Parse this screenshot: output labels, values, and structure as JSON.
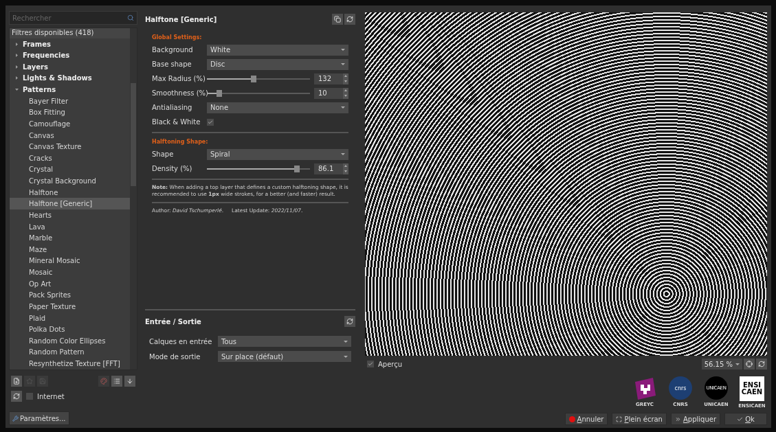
{
  "search": {
    "placeholder": "Rechercher"
  },
  "filters": {
    "header": "Filtres disponibles (418)",
    "categories": [
      {
        "label": "Frames",
        "expanded": false,
        "selected": false
      },
      {
        "label": "Frequencies",
        "expanded": false,
        "selected": false
      },
      {
        "label": "Layers",
        "expanded": false,
        "selected": false
      },
      {
        "label": "Lights & Shadows",
        "expanded": false,
        "selected": false
      },
      {
        "label": "Patterns",
        "expanded": true,
        "selected": false,
        "children": [
          {
            "label": "Bayer Filter",
            "selected": false
          },
          {
            "label": "Box Fitting",
            "selected": false
          },
          {
            "label": "Camouflage",
            "selected": false
          },
          {
            "label": "Canvas",
            "selected": false
          },
          {
            "label": "Canvas Texture",
            "selected": false
          },
          {
            "label": "Cracks",
            "selected": false
          },
          {
            "label": "Crystal",
            "selected": false
          },
          {
            "label": "Crystal Background",
            "selected": false
          },
          {
            "label": "Halftone",
            "selected": false
          },
          {
            "label": "Halftone [Generic]",
            "selected": true
          },
          {
            "label": "Hearts",
            "selected": false
          },
          {
            "label": "Lava",
            "selected": false
          },
          {
            "label": "Marble",
            "selected": false
          },
          {
            "label": "Maze",
            "selected": false
          },
          {
            "label": "Mineral Mosaic",
            "selected": false
          },
          {
            "label": "Mosaic",
            "selected": false
          },
          {
            "label": "Op Art",
            "selected": false
          },
          {
            "label": "Pack Sprites",
            "selected": false
          },
          {
            "label": "Paper Texture",
            "selected": false
          },
          {
            "label": "Plaid",
            "selected": false
          },
          {
            "label": "Polka Dots",
            "selected": false
          },
          {
            "label": "Random Color Ellipses",
            "selected": false
          },
          {
            "label": "Random Pattern",
            "selected": false
          },
          {
            "label": "Resynthetize Texture [FFT]",
            "selected": false
          }
        ]
      }
    ]
  },
  "internet": {
    "label": "Internet",
    "checked": false
  },
  "settings_button": "Paramètres...",
  "filter": {
    "title": "Halftone [Generic]",
    "params": [
      {
        "kind": "heading",
        "label": "Global Settings:"
      },
      {
        "kind": "select",
        "label": "Background",
        "value": "White"
      },
      {
        "kind": "select",
        "label": "Base shape",
        "value": "Disc"
      },
      {
        "kind": "slider",
        "label": "Max Radius (%)",
        "level": 0.45,
        "value": "132"
      },
      {
        "kind": "slider",
        "label": "Smoothness (%)",
        "level": 0.12,
        "value": "10"
      },
      {
        "kind": "select",
        "label": "Antialiasing",
        "value": "None"
      },
      {
        "kind": "checkbox",
        "label": "Black & White",
        "checked": true
      },
      {
        "kind": "separator"
      },
      {
        "kind": "heading",
        "label": "Halftoning Shape:"
      },
      {
        "kind": "select",
        "label": "Shape",
        "value": "Spiral"
      },
      {
        "kind": "slider",
        "label": "Density (%)",
        "level": 0.87,
        "value": "86.1"
      },
      {
        "kind": "separator"
      },
      {
        "kind": "note",
        "text": "**Note:** When adding a top layer that defines a custom halftoning shape, it is recommended to use **1px** wide strokes, for a better (and faster) result."
      },
      {
        "kind": "separator"
      },
      {
        "kind": "note",
        "text": "Author: *David Tschumperlé*.     Latest Update: *2022/11/07*."
      }
    ]
  },
  "io": {
    "title": "Entrée / Sortie",
    "rows": [
      {
        "label": "Calques en entrée",
        "value": "Tous"
      },
      {
        "label": "Mode de sortie",
        "value": "Sur place (défaut)"
      }
    ]
  },
  "preview": {
    "label": "Aperçu",
    "checked": true,
    "zoom": "56.15 %"
  },
  "logos": [
    {
      "kind": "greyc",
      "caption": "GREYC"
    },
    {
      "kind": "cnrs",
      "text": "cnrs",
      "caption": "CNRS"
    },
    {
      "kind": "unicaen",
      "text": "UNICAEN",
      "caption": "UNICAEN"
    },
    {
      "kind": "ensicaen",
      "text": "ENSI CAEN",
      "caption": "ENSICAEN"
    }
  ],
  "buttons": [
    {
      "kind": "cancel",
      "label": "Annuler"
    },
    {
      "kind": "fullscreen",
      "label": "Plein écran"
    },
    {
      "kind": "apply",
      "label": "Appliquer"
    },
    {
      "kind": "ok",
      "label": "Ok"
    }
  ]
}
